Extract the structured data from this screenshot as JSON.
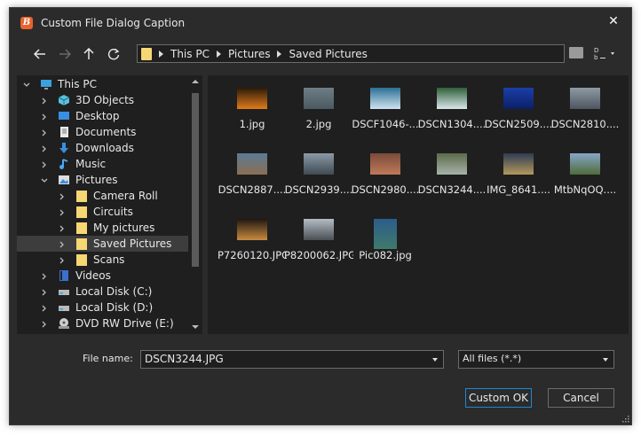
{
  "window": {
    "title": "Custom File Dialog Caption",
    "app_icon_letter": "B"
  },
  "toolbar": {
    "back_icon": "back-arrow-icon",
    "forward_icon": "forward-arrow-icon",
    "up_icon": "up-arrow-icon",
    "refresh_icon": "refresh-icon",
    "view_label": "D\nb"
  },
  "address": {
    "crumbs": [
      "This PC",
      "Pictures",
      "Saved Pictures"
    ]
  },
  "tree": {
    "items": [
      {
        "label": "This PC",
        "icon": "computer-icon",
        "indent": 0,
        "expanded": true
      },
      {
        "label": "3D Objects",
        "icon": "3d-objects-icon",
        "indent": 1
      },
      {
        "label": "Desktop",
        "icon": "desktop-icon",
        "indent": 1
      },
      {
        "label": "Documents",
        "icon": "documents-icon",
        "indent": 1
      },
      {
        "label": "Downloads",
        "icon": "downloads-icon",
        "indent": 1
      },
      {
        "label": "Music",
        "icon": "music-icon",
        "indent": 1
      },
      {
        "label": "Pictures",
        "icon": "pictures-icon",
        "indent": 1,
        "expanded": true
      },
      {
        "label": "Camera Roll",
        "icon": "folder-icon",
        "indent": 2
      },
      {
        "label": "Circuits",
        "icon": "folder-icon",
        "indent": 2
      },
      {
        "label": "My pictures",
        "icon": "folder-icon",
        "indent": 2
      },
      {
        "label": "Saved Pictures",
        "icon": "folder-icon",
        "indent": 2,
        "selected": true
      },
      {
        "label": "Scans",
        "icon": "folder-icon",
        "indent": 2
      },
      {
        "label": "Videos",
        "icon": "videos-icon",
        "indent": 1
      },
      {
        "label": "Local Disk (C:)",
        "icon": "disk-icon",
        "indent": 1
      },
      {
        "label": "Local Disk (D:)",
        "icon": "disk-icon",
        "indent": 1
      },
      {
        "label": "DVD RW Drive (E:)",
        "icon": "dvd-drive-icon",
        "indent": 1
      }
    ]
  },
  "files": [
    {
      "name": "1.jpg",
      "colors": [
        "#2a1a08",
        "#e07b1a"
      ]
    },
    {
      "name": "2.jpg",
      "colors": [
        "#6f7d86",
        "#4b5a60"
      ]
    },
    {
      "name": "DSCF1046-...",
      "colors": [
        "#2d6f95",
        "#cfe3ef"
      ]
    },
    {
      "name": "DSCN1304....",
      "colors": [
        "#2f5f3a",
        "#d9e6e9"
      ]
    },
    {
      "name": "DSCN2509....",
      "colors": [
        "#1a3fa8",
        "#0c1f66"
      ]
    },
    {
      "name": "DSCN2810....",
      "colors": [
        "#8e9aa3",
        "#4d5660"
      ]
    },
    {
      "name": "DSCN2887....",
      "colors": [
        "#5b7b94",
        "#8b6f52"
      ]
    },
    {
      "name": "DSCN2939....",
      "colors": [
        "#8a9aa6",
        "#3f4a52"
      ]
    },
    {
      "name": "DSCN2980....",
      "colors": [
        "#7a4b3a",
        "#c07a5a"
      ]
    },
    {
      "name": "DSCN3244....",
      "colors": [
        "#5c6a4a",
        "#a7b4a9"
      ]
    },
    {
      "name": "IMG_8641....",
      "colors": [
        "#2f3b54",
        "#b39a5c"
      ]
    },
    {
      "name": "MtbNqOQ....",
      "colors": [
        "#86a6c8",
        "#4f6b3a"
      ]
    },
    {
      "name": "P7260120.JPG",
      "colors": [
        "#1f1710",
        "#c98a40"
      ]
    },
    {
      "name": "P8200062.JPG",
      "colors": [
        "#b5bcc4",
        "#4a4f55"
      ]
    },
    {
      "name": "Pic082.jpg",
      "colors": [
        "#2c5d8c",
        "#3f7a6a"
      ]
    }
  ],
  "bottom": {
    "file_name_label": "File name:",
    "file_name_value": "DSCN3244.JPG",
    "filter_value": "All files (*.*)",
    "ok_label": "Custom OK",
    "cancel_label": "Cancel"
  },
  "colors": {
    "accent": "#1a8ad4",
    "background": "#2b2b2b",
    "panel": "#1f1f1f",
    "folder": "#f7d674"
  }
}
